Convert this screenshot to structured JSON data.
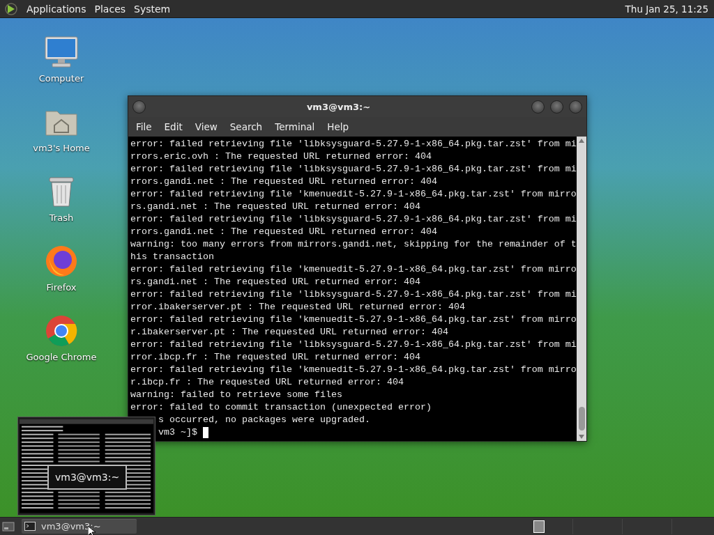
{
  "top_panel": {
    "menus": [
      "Applications",
      "Places",
      "System"
    ],
    "clock": "Thu Jan 25, 11:25"
  },
  "desktop_icons": [
    {
      "kind": "computer",
      "label": "Computer"
    },
    {
      "kind": "home",
      "label": "vm3's Home"
    },
    {
      "kind": "trash",
      "label": "Trash"
    },
    {
      "kind": "firefox",
      "label": "Firefox"
    },
    {
      "kind": "chrome",
      "label": "Google Chrome"
    }
  ],
  "terminal": {
    "title": "vm3@vm3:~",
    "menu": [
      "File",
      "Edit",
      "View",
      "Search",
      "Terminal",
      "Help"
    ],
    "lines": [
      {
        "kind": "line",
        "text": "error: failed retrieving file 'libksysguard-5.27.9-1-x86_64.pkg.tar.zst' from mi"
      },
      {
        "kind": "line",
        "text": "rrors.eric.ovh : The requested URL returned error: 404"
      },
      {
        "kind": "line",
        "text": "error: failed retrieving file 'libksysguard-5.27.9-1-x86_64.pkg.tar.zst' from mi"
      },
      {
        "kind": "line",
        "text": "rrors.gandi.net : The requested URL returned error: 404"
      },
      {
        "kind": "line",
        "text": "error: failed retrieving file 'kmenuedit-5.27.9-1-x86_64.pkg.tar.zst' from mirro"
      },
      {
        "kind": "line",
        "text": "rs.gandi.net : The requested URL returned error: 404"
      },
      {
        "kind": "line",
        "text": "error: failed retrieving file 'libksysguard-5.27.9-1-x86_64.pkg.tar.zst' from mi"
      },
      {
        "kind": "line",
        "text": "rrors.gandi.net : The requested URL returned error: 404"
      },
      {
        "kind": "line",
        "text": "warning: too many errors from mirrors.gandi.net, skipping for the remainder of t"
      },
      {
        "kind": "line",
        "text": "his transaction"
      },
      {
        "kind": "line",
        "text": "error: failed retrieving file 'kmenuedit-5.27.9-1-x86_64.pkg.tar.zst' from mirro"
      },
      {
        "kind": "line",
        "text": "rs.gandi.net : The requested URL returned error: 404"
      },
      {
        "kind": "line",
        "text": "error: failed retrieving file 'libksysguard-5.27.9-1-x86_64.pkg.tar.zst' from mi"
      },
      {
        "kind": "line",
        "text": "rror.ibakerserver.pt : The requested URL returned error: 404"
      },
      {
        "kind": "line",
        "text": "error: failed retrieving file 'kmenuedit-5.27.9-1-x86_64.pkg.tar.zst' from mirro"
      },
      {
        "kind": "line",
        "text": "r.ibakerserver.pt : The requested URL returned error: 404"
      },
      {
        "kind": "line",
        "text": "error: failed retrieving file 'libksysguard-5.27.9-1-x86_64.pkg.tar.zst' from mi"
      },
      {
        "kind": "line",
        "text": "rror.ibcp.fr : The requested URL returned error: 404"
      },
      {
        "kind": "line",
        "text": "error: failed retrieving file 'kmenuedit-5.27.9-1-x86_64.pkg.tar.zst' from mirro"
      },
      {
        "kind": "line",
        "text": "r.ibcp.fr : The requested URL returned error: 404"
      },
      {
        "kind": "line",
        "text": "warning: failed to retrieve some files"
      },
      {
        "kind": "line",
        "text": "error: failed to commit transaction (unexpected error)"
      },
      {
        "kind": "cut3",
        "text": "s occurred, no packages were upgraded."
      },
      {
        "kind": "prompt",
        "text": "vm3 ~]$"
      }
    ]
  },
  "preview": {
    "tooltip": "vm3@vm3:~"
  },
  "taskbar": {
    "windows": [
      {
        "title": "vm3@vm3:~",
        "selected": true
      }
    ]
  }
}
